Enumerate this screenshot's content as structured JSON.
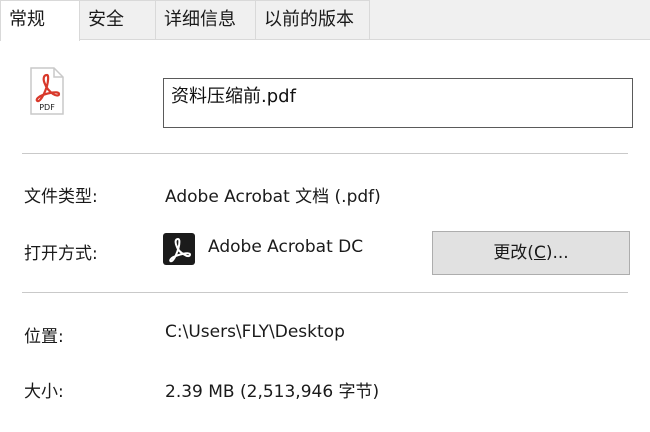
{
  "tabs": [
    {
      "label": "常规"
    },
    {
      "label": "安全"
    },
    {
      "label": "详细信息"
    },
    {
      "label": "以前的版本"
    }
  ],
  "file": {
    "icon": "pdf-file-icon",
    "icon_text": "PDF",
    "name": "资料压缩前.pdf"
  },
  "properties": {
    "type_label": "文件类型:",
    "type_value": "Adobe Acrobat 文档 (.pdf)",
    "opens_with_label": "打开方式:",
    "opens_with_app": "Adobe Acrobat DC",
    "change_button_prefix": "更改(",
    "change_button_accel": "C",
    "change_button_suffix": ")...",
    "location_label": "位置:",
    "location_value": "C:\\Users\\FLY\\Desktop",
    "size_label": "大小:",
    "size_value": "2.39 MB (2,513,946 字节)"
  },
  "colors": {
    "pdf_red": "#d8392b",
    "app_icon_bg": "#1b1b1b",
    "tab_bg": "#f0f0f0",
    "button_bg": "#e1e1e1"
  }
}
